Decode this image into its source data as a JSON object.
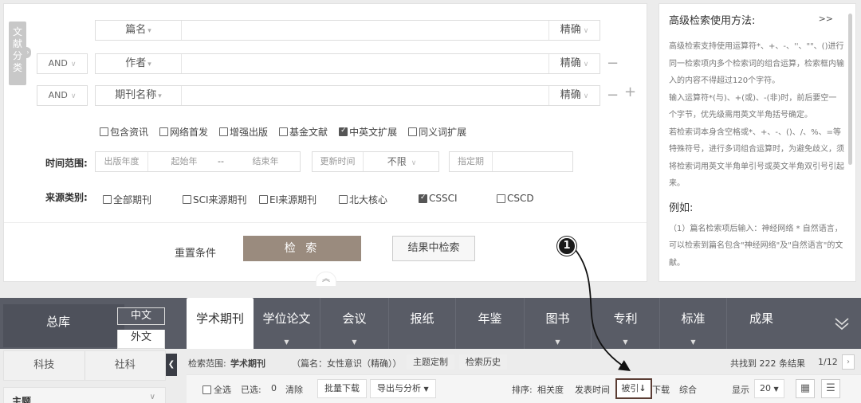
{
  "side_tab": {
    "label": "文献分类"
  },
  "search_form": {
    "rows": [
      {
        "field": "篇名",
        "match": "精确"
      },
      {
        "logic": "AND",
        "field": "作者",
        "match": "精确"
      },
      {
        "logic": "AND",
        "field": "期刊名称",
        "match": "精确"
      }
    ],
    "extra_checkboxes": [
      {
        "label": "包含资讯",
        "checked": false
      },
      {
        "label": "网络首发",
        "checked": false
      },
      {
        "label": "增强出版",
        "checked": false
      },
      {
        "label": "基金文献",
        "checked": false
      },
      {
        "label": "中英文扩展",
        "checked": true
      },
      {
        "label": "同义词扩展",
        "checked": false
      }
    ],
    "time_range": {
      "label": "时间范围:",
      "publish_year": "出版年度",
      "start_year": "起始年",
      "dash": "--",
      "end_year": "结束年",
      "update_time": "更新时间",
      "unlimited": "不限",
      "specified": "指定期"
    },
    "source": {
      "label": "来源类别:",
      "options": [
        {
          "label": "全部期刊",
          "checked": false
        },
        {
          "label": "SCI来源期刊",
          "checked": false
        },
        {
          "label": "EI来源期刊",
          "checked": false
        },
        {
          "label": "北大核心",
          "checked": false
        },
        {
          "label": "CSSCI",
          "checked": true
        },
        {
          "label": "CSCD",
          "checked": false
        }
      ]
    },
    "reset_label": "重置条件",
    "search_label": "检 索",
    "search_in_results_label": "结果中检索"
  },
  "help": {
    "title": "高级检索使用方法:",
    "toggle": ">>",
    "paragraphs": [
      "高级检索支持使用运算符*、+、-、''、\"\"、()进行同一检索项内多个检索词的组合运算，检索框内输入的内容不得超过120个字符。",
      "输入运算符*(与)、+(或)、-(非)时，前后要空一个字节，优先级需用英文半角括号确定。",
      "若检索词本身含空格或*、+、-、()、/、%、=等特殊符号，进行多词组合运算时，为避免歧义，须将检索词用英文半角单引号或英文半角双引号引起来。"
    ],
    "example_title": "例如:",
    "example": "（1）篇名检索项后输入：神经网络 * 自然语言，可以检索到篇名包含\"神经网络\"及\"自然语言\"的文献。"
  },
  "callout": {
    "number": "1"
  },
  "nav": {
    "total_library": "总库",
    "lang_zh": "中文",
    "lang_en": "外文",
    "tabs": [
      {
        "label": "学术期刊",
        "active": true
      },
      {
        "label": "学位论文"
      },
      {
        "label": "会议"
      },
      {
        "label": "报纸"
      },
      {
        "label": "年鉴"
      },
      {
        "label": "图书"
      },
      {
        "label": "专利"
      },
      {
        "label": "标准"
      },
      {
        "label": "成果"
      }
    ]
  },
  "left_panel": {
    "tabs": [
      "科技",
      "社科"
    ],
    "facet_title": "主题"
  },
  "results": {
    "scope_label": "检索范围:",
    "scope_value": "学术期刊",
    "query_text": "（篇名：女性意识（精确））",
    "theme_custom": "主题定制",
    "search_history": "检索历史",
    "found_prefix": "共找到",
    "count": "222",
    "found_suffix": "条结果",
    "page": "1/12"
  },
  "toolbar": {
    "select_all": "全选",
    "selected_label": "已选:",
    "selected_count": "0",
    "clear": "清除",
    "batch_download": "批量下载",
    "export": "导出与分析",
    "sort_label": "排序:",
    "sort_relevance": "相关度",
    "sort_date": "发表时间",
    "sort_cited": "被引",
    "sort_download": "下载",
    "sort_combined": "综合",
    "display_label": "显示",
    "display_count": "20"
  }
}
